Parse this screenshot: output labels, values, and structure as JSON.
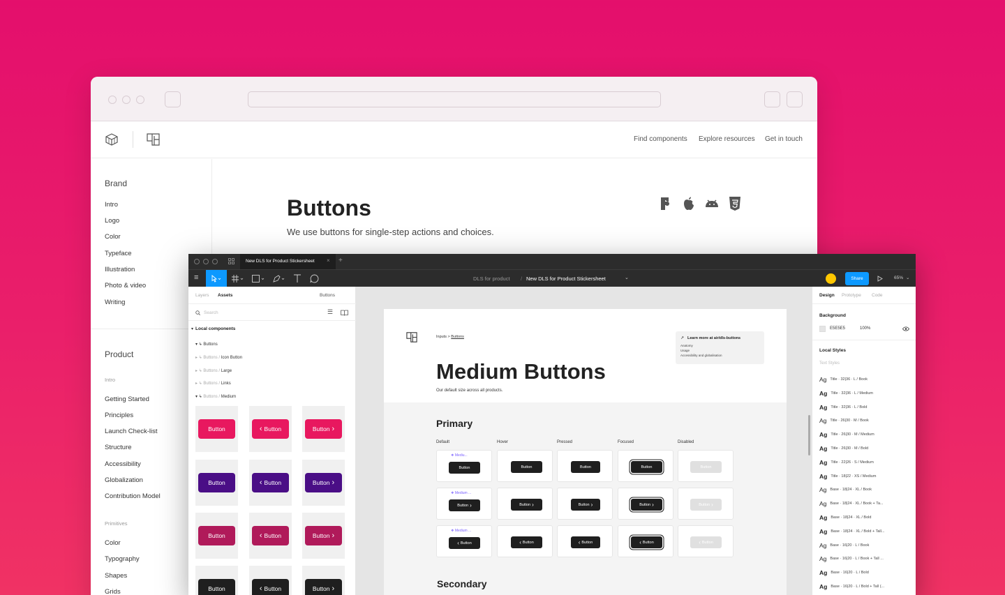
{
  "site": {
    "nav": [
      "Find components",
      "Explore resources",
      "Get in touch"
    ],
    "sidebar_brand_title": "Brand",
    "sidebar_brand_items": [
      "Intro",
      "Logo",
      "Color",
      "Typeface",
      "Illustration",
      "Photo & video",
      "Writing"
    ],
    "sidebar_product_title": "Product",
    "sidebar_product_intro": "Intro",
    "sidebar_product_items": [
      "Getting Started",
      "Principles",
      "Launch Check-list",
      "Structure",
      "Accessibility",
      "Globalization",
      "Contribution Model"
    ],
    "sidebar_primitives_title": "Primitives",
    "sidebar_primitives_items": [
      "Color",
      "Typography",
      "Shapes",
      "Grids"
    ],
    "page_title": "Buttons",
    "page_subtitle": "We use buttons for single-step actions and choices.",
    "platform_icons": [
      "figma-icon",
      "apple-icon",
      "android-icon",
      "html5-icon"
    ]
  },
  "figma": {
    "tab_title": "New DLS for Product Stickersheet",
    "breadcrumb_project": "DLS for product",
    "breadcrumb_file": "New DLS for Product Stickersheet",
    "share_label": "Share",
    "zoom": "65%",
    "left_tabs": [
      "Layers",
      "Assets"
    ],
    "left_tab_right": "Buttons",
    "search_placeholder": "Search",
    "local_components": "Local components",
    "tree": [
      {
        "prefix": "",
        "name": "Buttons"
      },
      {
        "prefix": "Buttons / ",
        "name": "Icon Button"
      },
      {
        "prefix": "Buttons / ",
        "name": "Large"
      },
      {
        "prefix": "Buttons / ",
        "name": "Links"
      },
      {
        "prefix": "Buttons / ",
        "name": "Medium"
      }
    ],
    "asset_button_label": "Button",
    "asset_row_colors": [
      "#e8185f",
      "#4a0e86",
      "#b01a5a",
      "#1f1f1f"
    ],
    "canvas": {
      "breadcrumb_parent": "Inputs",
      "breadcrumb_sep": ">",
      "breadcrumb_current": "Buttons",
      "learn_more": "Learn more at air/dls-buttons",
      "learn_links": [
        "Anatomy",
        "Usage",
        "Accessibility and globalisation"
      ],
      "title": "Medium Buttons",
      "subtitle": "Our default size across all products.",
      "primary_heading": "Primary",
      "states": [
        "Default",
        "Hover",
        "Pressed",
        "Focused",
        "Disabled"
      ],
      "component_tag": "Medium ...",
      "component_tag_first": "Mediu...",
      "button_label": "Button",
      "secondary_heading": "Secondary"
    },
    "right_tabs": [
      "Design",
      "Prototype",
      "Code"
    ],
    "background_label": "Background",
    "background_hex": "E5E5E5",
    "background_opacity": "100%",
    "local_styles": "Local Styles",
    "text_styles": "Text Styles",
    "styles": [
      "Title · 32|36 · L / Book",
      "Title · 32|36 · L / Medium",
      "Title · 32|36 · L / Bold",
      "Title · 26|30 · M / Book",
      "Title · 26|30 · M / Medium",
      "Title · 26|30 · M / Bold",
      "Title · 22|26 · S / Medium",
      "Title · 18|22 · XS / Medium",
      "Base · 18|24 · XL / Book",
      "Base · 18|24 · XL / Book + Ta...",
      "Base · 18|24 · XL / Bold",
      "Base · 18|24 · XL / Bold + Tall...",
      "Base · 16|20 · L / Book",
      "Base · 16|20 · L / Book + Tall ...",
      "Base · 16|20 · L / Bold",
      "Base · 16|20 · L / Bold + Tall (..."
    ],
    "style_glyph": "Ag"
  },
  "colors": {
    "accent": "#e40f6c",
    "share": "#0d99ff",
    "avatar": "#ffc700",
    "component_purple": "#7b61ff"
  }
}
